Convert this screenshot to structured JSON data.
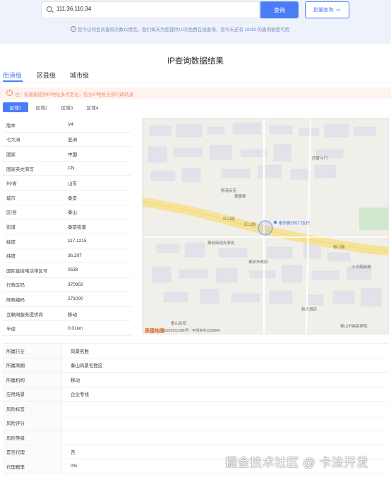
{
  "search": {
    "value": "111.36.110.34",
    "button": "查询",
    "batch_button": "批量查询",
    "batch_arrow": "⇨"
  },
  "notice": {
    "prefix": "您今日的会员查询次数以用完，我们每天为您提供10次免费在线查询，您今天还有 ",
    "highlight": "10/10",
    "suffix": " 的查询额度可用"
  },
  "result_title": "IP查询数据结果",
  "level_tabs": [
    "街道级",
    "区县级",
    "城市级"
  ],
  "warning": "注：街道级提供IP地址多点定位，包含IP地址全部行政轨道",
  "area_tabs": [
    "区域1",
    "区域2",
    "区域3",
    "区域4"
  ],
  "details": [
    {
      "k": "版本",
      "v": "V4"
    },
    {
      "k": "七大洲",
      "v": "亚洲"
    },
    {
      "k": "国家",
      "v": "中国"
    },
    {
      "k": "国家英文简写",
      "v": "CN"
    },
    {
      "k": "州/省",
      "v": "山东"
    },
    {
      "k": "城市",
      "v": "泰安"
    },
    {
      "k": "区/县",
      "v": "泰山"
    },
    {
      "k": "街道",
      "v": "泰前街道"
    },
    {
      "k": "经度",
      "v": "117.1215"
    },
    {
      "k": "纬度",
      "v": "36.207"
    },
    {
      "k": "国际直拨电话带区号",
      "v": "0538"
    },
    {
      "k": "行政区码",
      "v": "370902"
    },
    {
      "k": "邮政编码",
      "v": "271000"
    },
    {
      "k": "互联网服务提供商",
      "v": "移动"
    },
    {
      "k": "半径",
      "v": "0.01km"
    }
  ],
  "map": {
    "labels": [
      "西普斗门",
      "照港名苑",
      "泰盟泰",
      "泰安银行红门支行",
      "红山路",
      "泰前街道办事处",
      "红山路",
      "泰山路",
      "泰安市政府",
      "小天鹅商城",
      "新大酒店",
      "泰山名苑",
      "泰山书画高研院",
      "高德地图"
    ],
    "copyright": "GS(2025)1980号 - 甲测资字1100849"
  },
  "extra": [
    {
      "k": "所属行业",
      "v": "风景名胜"
    },
    {
      "k": "所属商圈",
      "v": "泰山风景名胜区"
    },
    {
      "k": "所属机构",
      "v": "移动"
    },
    {
      "k": "应用场景",
      "v": "企业专线"
    },
    {
      "k": "风险标签",
      "v": ""
    },
    {
      "k": "风险评分",
      "v": ""
    },
    {
      "k": "风险等级",
      "v": ""
    },
    {
      "k": "是否代理",
      "v": "否"
    },
    {
      "k": "代理概率",
      "v": "0%"
    }
  ],
  "watermark": "掘金技术社区 @ 卡法开发",
  "colors": {
    "accent": "#4a7cf6",
    "warning": "#f08a66",
    "road": "#f6e39a",
    "green": "#cfe8cf"
  }
}
